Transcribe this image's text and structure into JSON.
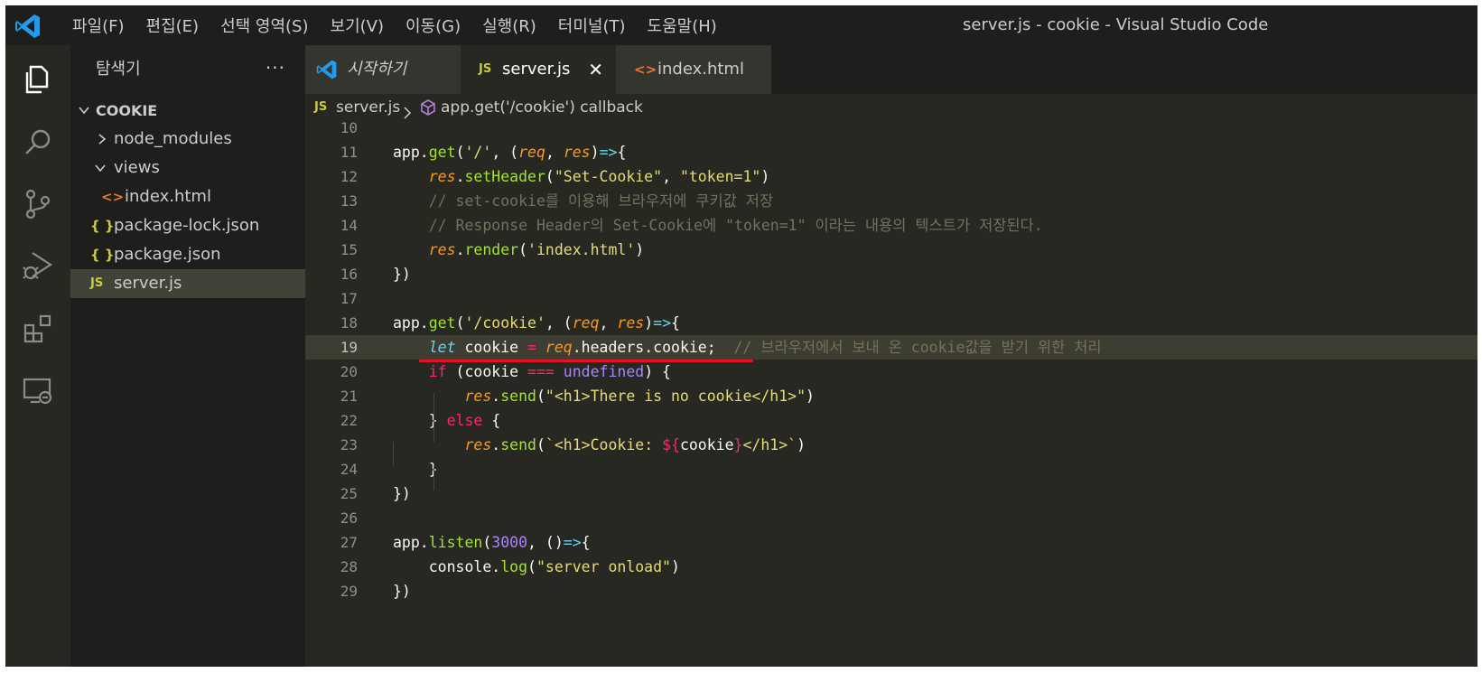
{
  "titlebar": {
    "menus": [
      "파일(F)",
      "편집(E)",
      "선택 영역(S)",
      "보기(V)",
      "이동(G)",
      "실행(R)",
      "터미널(T)",
      "도움말(H)"
    ],
    "window_title": "server.js - cookie - Visual Studio Code"
  },
  "activity_bar": {
    "icons": [
      "explorer-icon",
      "search-icon",
      "source-control-icon",
      "run-debug-icon",
      "extensions-icon",
      "remote-explorer-icon"
    ]
  },
  "sidebar": {
    "title": "탐색기",
    "more": "···",
    "root": "COOKIE",
    "items": [
      {
        "label": "node_modules",
        "icon": "chevron-right"
      },
      {
        "label": "views",
        "icon": "chevron-down"
      },
      {
        "label": "index.html",
        "icon": "html"
      },
      {
        "label": "package-lock.json",
        "icon": "json"
      },
      {
        "label": "package.json",
        "icon": "json"
      },
      {
        "label": "server.js",
        "icon": "js",
        "selected": true
      }
    ],
    "json_glyph": "{ }",
    "js_glyph": "JS",
    "html_glyph": "<>"
  },
  "tabs": [
    {
      "label": "시작하기",
      "icon": "vscode-logo"
    },
    {
      "label": "server.js",
      "icon": "js",
      "active": true,
      "close": "✕"
    },
    {
      "label": "index.html",
      "icon": "html"
    }
  ],
  "breadcrumb": {
    "file": "server.js",
    "symbol": "app.get('/cookie') callback"
  },
  "editor": {
    "current_line": 19,
    "lines": [
      {
        "n": "10",
        "text": ""
      },
      {
        "n": "11",
        "text": "app.get('/', (req, res)=>{"
      },
      {
        "n": "12",
        "text": "    res.setHeader(\"Set-Cookie\", \"token=1\")"
      },
      {
        "n": "13",
        "text": "    // set-cookie를 이용해 브라우저에 쿠키값 저장"
      },
      {
        "n": "14",
        "text": "    // Response Header의 Set-Cookie에 \"token=1\" 이라는 내용의 텍스트가 저장된다."
      },
      {
        "n": "15",
        "text": "    res.render('index.html')"
      },
      {
        "n": "16",
        "text": "})"
      },
      {
        "n": "17",
        "text": ""
      },
      {
        "n": "18",
        "text": "app.get('/cookie', (req, res)=>{"
      },
      {
        "n": "19",
        "text": "    let cookie = req.headers.cookie;  // 브라우저에서 보내 온 cookie값을 받기 위한 처리"
      },
      {
        "n": "20",
        "text": "    if (cookie === undefined) {"
      },
      {
        "n": "21",
        "text": "        res.send(\"<h1>There is no cookie</h1>\")"
      },
      {
        "n": "22",
        "text": "    } else {"
      },
      {
        "n": "23",
        "text": "        res.send(`<h1>Cookie: ${cookie}</h1>`)"
      },
      {
        "n": "24",
        "text": "    }"
      },
      {
        "n": "25",
        "text": "})"
      },
      {
        "n": "26",
        "text": ""
      },
      {
        "n": "27",
        "text": "app.listen(3000, ()=>{"
      },
      {
        "n": "28",
        "text": "    console.log(\"server onload\")"
      },
      {
        "n": "29",
        "text": "})"
      }
    ]
  },
  "colors": {
    "background": "#272822",
    "keyword": "#f92672",
    "function": "#a6e22e",
    "string": "#e6db74",
    "parameter": "#fd971f",
    "storage": "#66d9ef",
    "number": "#ae81ff",
    "comment": "#75715e",
    "annotation_underline": "#e81123"
  }
}
